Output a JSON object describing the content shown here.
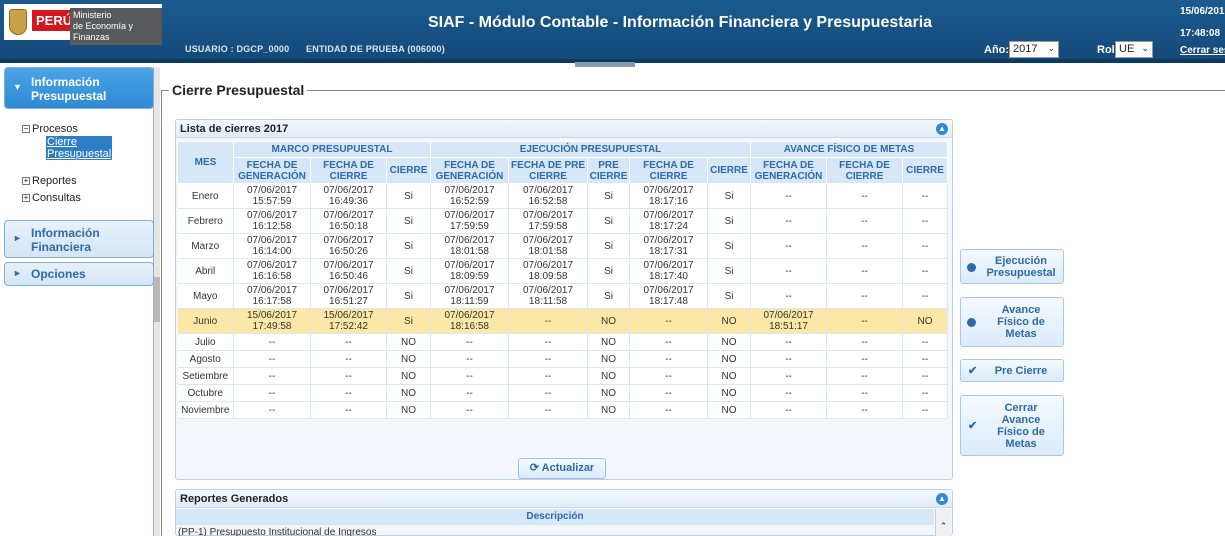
{
  "header": {
    "peru": "PERÚ",
    "ministerio": "Ministerio",
    "ministerio2": "de Economía y Finanzas",
    "title": "SIAF - Módulo Contable - Información Financiera y Presupuestaria",
    "usuario": "USUARIO : DGCP_0000",
    "entidad": "ENTIDAD DE PRUEBA (006000)",
    "anio_label": "Año:",
    "anio_value": "2017",
    "rol_label": "Rol:",
    "rol_value": "UE",
    "date": "15/06/201",
    "time": "17:48:08",
    "logout": "Cerrar ses"
  },
  "sidebar": {
    "info_presupuestal": [
      "Información",
      "Presupuestal"
    ],
    "procesos": "Procesos",
    "cierre": [
      "Cierre",
      "Presupuestal"
    ],
    "reportes": "Reportes",
    "consultas": "Consultas",
    "info_financiera": [
      "Información",
      "Financiera"
    ],
    "opciones": "Opciones"
  },
  "main": {
    "legend": "Cierre Presupuestal",
    "panel_title": "Lista de cierres 2017",
    "groups": [
      "MARCO PRESUPUESTAL",
      "EJECUCIÓN PRESUPUESTAL",
      "AVANCE FÍSICO DE METAS"
    ],
    "col_mes": "MES",
    "cols": [
      "FECHA DE GENERACIÓN",
      "FECHA DE CIERRE",
      "CIERRE",
      "FECHA DE GENERACIÓN",
      "FECHA DE PRE CIERRE",
      "PRE CIERRE",
      "FECHA DE CIERRE",
      "CIERRE",
      "FECHA DE GENERACIÓN",
      "FECHA DE CIERRE",
      "CIERRE"
    ],
    "rows": [
      [
        "Enero",
        "07/06/2017|15:57:59",
        "07/06/2017|16:49:36",
        "Si",
        "07/06/2017|16:52:59",
        "07/06/2017|16:52:58",
        "Si",
        "07/06/2017|18:17:16",
        "Si",
        "--",
        "--",
        "--"
      ],
      [
        "Febrero",
        "07/06/2017|16:12:58",
        "07/06/2017|16:50:18",
        "Si",
        "07/06/2017|17:59:59",
        "07/06/2017|17:59:58",
        "Si",
        "07/06/2017|18:17:24",
        "Si",
        "--",
        "--",
        "--"
      ],
      [
        "Marzo",
        "07/06/2017|16:14:00",
        "07/06/2017|16:50:26",
        "Si",
        "07/06/2017|18:01:58",
        "07/06/2017|18:01:58",
        "Si",
        "07/06/2017|18:17:31",
        "Si",
        "--",
        "--",
        "--"
      ],
      [
        "Abril",
        "07/06/2017|16:16:58",
        "07/06/2017|16:50:46",
        "Si",
        "07/06/2017|18:09:59",
        "07/06/2017|18:09:58",
        "Si",
        "07/06/2017|18:17:40",
        "Si",
        "--",
        "--",
        "--"
      ],
      [
        "Mayo",
        "07/06/2017|16:17:58",
        "07/06/2017|16:51:27",
        "Si",
        "07/06/2017|18:11:59",
        "07/06/2017|18:11:58",
        "Si",
        "07/06/2017|18:17:48",
        "Si",
        "--",
        "--",
        "--"
      ],
      [
        "Junio",
        "15/06/2017|17:49:58",
        "15/06/2017|17:52:42",
        "Si",
        "07/06/2017|18:16:58",
        "--",
        "NO",
        "--",
        "NO",
        "07/06/2017|18:51:17",
        "--",
        "NO"
      ],
      [
        "Julio",
        "--",
        "--",
        "NO",
        "--",
        "--",
        "NO",
        "--",
        "NO",
        "--",
        "--",
        "--"
      ],
      [
        "Agosto",
        "--",
        "--",
        "NO",
        "--",
        "--",
        "NO",
        "--",
        "NO",
        "--",
        "--",
        "--"
      ],
      [
        "Setiembre",
        "--",
        "--",
        "NO",
        "--",
        "--",
        "NO",
        "--",
        "NO",
        "--",
        "--",
        "--"
      ],
      [
        "Octubre",
        "--",
        "--",
        "NO",
        "--",
        "--",
        "NO",
        "--",
        "NO",
        "--",
        "--",
        "--"
      ],
      [
        "Noviembre",
        "--",
        "--",
        "NO",
        "--",
        "--",
        "NO",
        "--",
        "NO",
        "--",
        "--",
        "--"
      ]
    ],
    "highlight_row": 5,
    "actualizar": "Actualizar",
    "reportes_title": "Reportes Generados",
    "descripcion": "Descripción",
    "reporte_row": "(PP-1) Presupuesto Institucional de Ingresos"
  },
  "actions": {
    "ejecucion": [
      "Ejecución",
      "Presupuestal"
    ],
    "avance": [
      "Avance",
      "Físico de",
      "Metas"
    ],
    "pre_cierre": "Pre Cierre",
    "cerrar_avance": [
      "Cerrar",
      "Avance",
      "Físico de",
      "Metas"
    ]
  },
  "colors": {
    "header_bg": "#1c5a8f",
    "accent": "#2e6aa8",
    "highlight_row": "#fbe8a6"
  }
}
